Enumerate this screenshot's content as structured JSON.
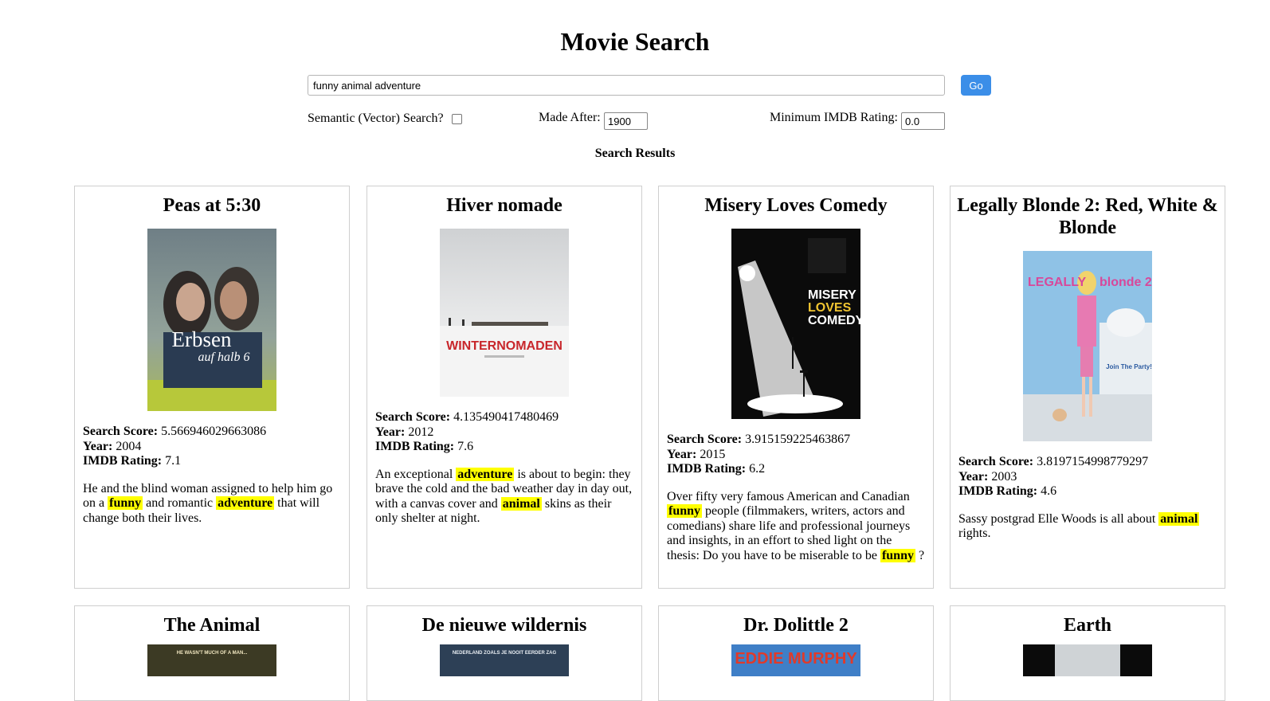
{
  "page": {
    "title": "Movie Search"
  },
  "search": {
    "query": "funny animal adventure",
    "go_label": "Go"
  },
  "filters": {
    "vector_label": "Semantic (Vector) Search?",
    "vector_checked": false,
    "made_after_label": "Made After:",
    "made_after_value": "1900",
    "min_rating_label": "Minimum IMDB Rating:",
    "min_rating_value": "0.0"
  },
  "results": {
    "heading": "Search Results",
    "score_label": "Search Score:",
    "year_label": "Year:",
    "rating_label": "IMDB Rating:",
    "cards": [
      {
        "title": "Peas at 5:30",
        "score": "5.566946029663086",
        "year": "2004",
        "rating": "7.1",
        "poster_text": [
          "Erbsen",
          "auf halb 6"
        ],
        "desc": [
          {
            "t": "He and the blind woman assigned to help him go on a "
          },
          {
            "t": "funny",
            "hl": true
          },
          {
            "t": " and romantic "
          },
          {
            "t": "adventure",
            "hl": true
          },
          {
            "t": " that will change both their lives."
          }
        ]
      },
      {
        "title": "Hiver nomade",
        "score": "4.135490417480469",
        "year": "2012",
        "rating": "7.6",
        "poster_text": [
          "WINTERNOMADEN"
        ],
        "desc": [
          {
            "t": "An exceptional "
          },
          {
            "t": "adventure",
            "hl": true
          },
          {
            "t": " is about to begin: they brave the cold and the bad weather day in day out, with a canvas cover and "
          },
          {
            "t": "animal",
            "hl": true
          },
          {
            "t": " skins as their only shelter at night."
          }
        ]
      },
      {
        "title": "Misery Loves Comedy",
        "score": "3.915159225463867",
        "year": "2015",
        "rating": "6.2",
        "poster_text": [
          "MISERY",
          "LOVES",
          "COMEDY"
        ],
        "desc": [
          {
            "t": "Over fifty very famous American and Canadian "
          },
          {
            "t": "funny",
            "hl": true
          },
          {
            "t": " people (filmmakers, writers, actors and comedians) share life and professional journeys and insights, in an effort to shed light on the thesis: Do you have to be miserable to be "
          },
          {
            "t": "funny",
            "hl": true
          },
          {
            "t": " ?"
          }
        ]
      },
      {
        "title": "Legally Blonde 2: Red, White & Blonde",
        "score": "3.8197154998779297",
        "year": "2003",
        "rating": "4.6",
        "poster_text": [
          "LEGALLY",
          "blonde 2",
          "Join The Party!"
        ],
        "desc": [
          {
            "t": "Sassy postgrad Elle Woods is all about "
          },
          {
            "t": "animal",
            "hl": true
          },
          {
            "t": " rights."
          }
        ]
      }
    ],
    "next_row": [
      {
        "title": "The Animal",
        "poster_text": "HE WASN'T MUCH OF A MAN..."
      },
      {
        "title": "De nieuwe wildernis",
        "poster_text": "NEDERLAND ZOALS JE NOOIT EERDER ZAG"
      },
      {
        "title": "Dr. Dolittle 2",
        "poster_text": "EDDIE MURPHY"
      },
      {
        "title": "Earth",
        "poster_text": ""
      }
    ]
  }
}
